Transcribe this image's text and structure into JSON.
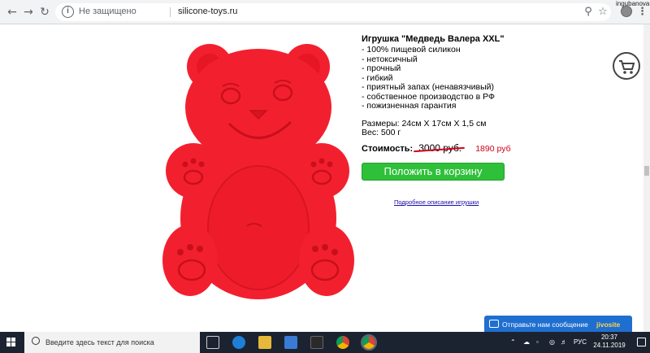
{
  "browser": {
    "back_icon": "back-arrow-icon",
    "forward_icon": "forward-arrow-icon",
    "reload_icon": "reload-icon",
    "security_text": "Не защищено",
    "url": "silicone-toys.ru",
    "zoom_icon": "zoom-icon",
    "bookmark_icon": "star-icon",
    "username": "ingubanova"
  },
  "product": {
    "title": "Игрушка \"Медведь Валера XXL\"",
    "features": [
      "- 100% пищевой силикон",
      "- нетоксичный",
      "- прочный",
      "- гибкий",
      "- приятный запах (ненавязчивый)",
      "- собственное производство в РФ",
      "- пожизненная гарантия"
    ],
    "sizes": "Размеры: 24см X 17см X 1,5 см",
    "weight": "Вес: 500 г",
    "price_label": "Стоимость:",
    "old_price": "3000 руб.",
    "new_price": "1890 руб",
    "cart_button": "Положить в корзину",
    "details_link": "Подробное описание игрушки",
    "bear_color": "#f2202f"
  },
  "chat": {
    "message": "Отправьте нам сообщение",
    "brand": "jivosite"
  },
  "taskbar": {
    "search_placeholder": "Введите здесь текст для поиска",
    "language": "РУС",
    "time": "20:37",
    "date": "24.11.2019"
  }
}
